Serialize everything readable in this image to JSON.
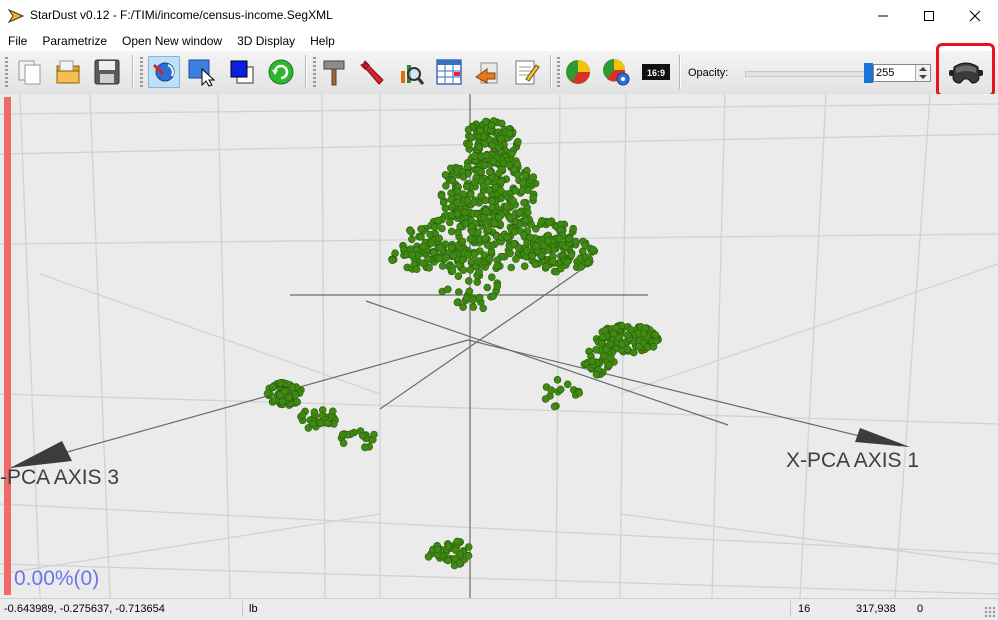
{
  "window": {
    "title": "StarDust v0.12 - F:/TIMi/income/census-income.SegXML",
    "controls": {
      "minimize": "minimize",
      "maximize": "maximize",
      "close": "close"
    }
  },
  "menu": {
    "items": [
      {
        "label": "File"
      },
      {
        "label": "Parametrize"
      },
      {
        "label": "Open New window"
      },
      {
        "label": "3D Display"
      },
      {
        "label": "Help"
      }
    ]
  },
  "toolbar": {
    "buttons": [
      {
        "icon": "copy-icon"
      },
      {
        "icon": "open-folder-icon"
      },
      {
        "icon": "save-icon"
      },
      {
        "icon": "rotate-view-icon",
        "active": true
      },
      {
        "icon": "select-pointer-icon"
      },
      {
        "icon": "color-picker-icon"
      },
      {
        "icon": "refresh-icon"
      },
      {
        "icon": "hammer-icon"
      },
      {
        "icon": "wrench-icon"
      },
      {
        "icon": "magnify-chart-icon"
      },
      {
        "icon": "table-icon"
      },
      {
        "icon": "export-icon"
      },
      {
        "icon": "notepad-icon"
      },
      {
        "icon": "pie-chart-icon"
      },
      {
        "icon": "pie-settings-icon"
      },
      {
        "icon": "aspect-ratio-icon",
        "text": "16:9"
      }
    ],
    "opacity_label": "Opacity:",
    "opacity_value": "255",
    "opacity_level": 1.0,
    "vr_button_icon": "vr-headset-icon",
    "highlight_color": "#e8141b"
  },
  "viewport": {
    "background_color": "#ebebeb",
    "point_color": "#3f8a12",
    "progress_color": "#f06a6a",
    "axis_label_x": "X-PCA AXIS 1",
    "axis_label_z": "-PCA AXIS 3",
    "progress_text": "0.00%(0)"
  },
  "status": {
    "coords": "-0.643989, -0.275637, -0.713654",
    "unit": "lb",
    "count": "16",
    "value": "317,938",
    "extra": "0"
  }
}
